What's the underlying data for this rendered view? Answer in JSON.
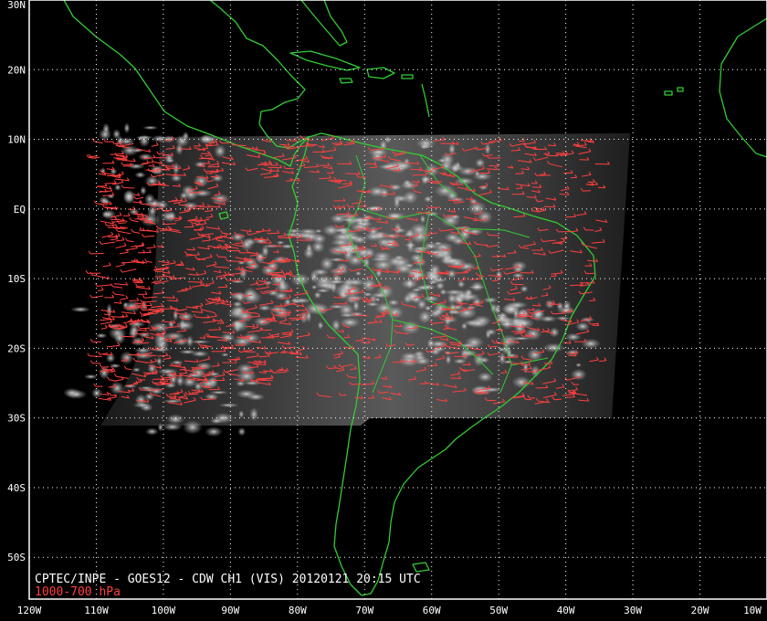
{
  "title": "CPTEC/INPE - GOES12 - CDW CH1 (VIS) 20120121 20:15 UTC",
  "level_label": "1000-700 hPa",
  "colors": {
    "background": "#000000",
    "coastline": "#33cc33",
    "wind_vectors": "#ff4040",
    "grid": "#ffffff",
    "labels": "#ffffff",
    "level_label": "#ff4040"
  },
  "lon_labels": [
    "120W",
    "110W",
    "100W",
    "90W",
    "80W",
    "70W",
    "60W",
    "50W",
    "40W",
    "30W",
    "20W",
    "10W"
  ],
  "lat_labels": [
    "30N",
    "20N",
    "10N",
    "EQ",
    "10S",
    "20S",
    "30S",
    "40S",
    "50S"
  ],
  "lon_range": [
    -120,
    -10
  ],
  "lat_range": [
    -56,
    30
  ],
  "satellite_coverage": {
    "lon": [
      -110,
      -30
    ],
    "lat": [
      -30,
      11
    ]
  },
  "grid": "dotted"
}
